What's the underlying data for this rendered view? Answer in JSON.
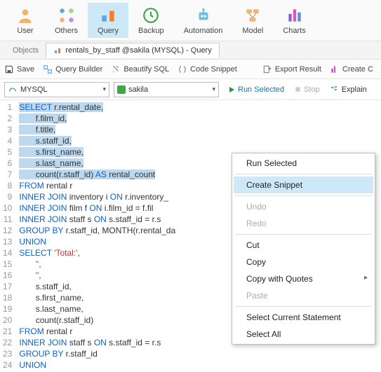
{
  "ribbon": [
    {
      "label": "User",
      "name": "user"
    },
    {
      "label": "Others",
      "name": "others"
    },
    {
      "label": "Query",
      "name": "query",
      "active": true
    },
    {
      "label": "Backup",
      "name": "backup"
    },
    {
      "label": "Automation",
      "name": "automation"
    },
    {
      "label": "Model",
      "name": "model"
    },
    {
      "label": "Charts",
      "name": "charts"
    }
  ],
  "tabs": {
    "objects": "Objects",
    "active": "rentals_by_staff @sakila (MYSQL) - Query"
  },
  "toolbar": {
    "save": "Save",
    "qb": "Query Builder",
    "beautify": "Beautify SQL",
    "snippet": "Code Snippet",
    "export": "Export Result",
    "createc": "Create C"
  },
  "selectors": {
    "conn": "MYSQL",
    "db": "sakila",
    "run": "Run Selected",
    "stop": "Stop",
    "explain": "Explain"
  },
  "ctx": {
    "run": "Run Selected",
    "create": "Create Snippet",
    "undo": "Undo",
    "redo": "Redo",
    "cut": "Cut",
    "copy": "Copy",
    "copyq": "Copy with Quotes",
    "paste": "Paste",
    "selstmt": "Select Current Statement",
    "selall": "Select All"
  },
  "code": {
    "lines": 24
  }
}
